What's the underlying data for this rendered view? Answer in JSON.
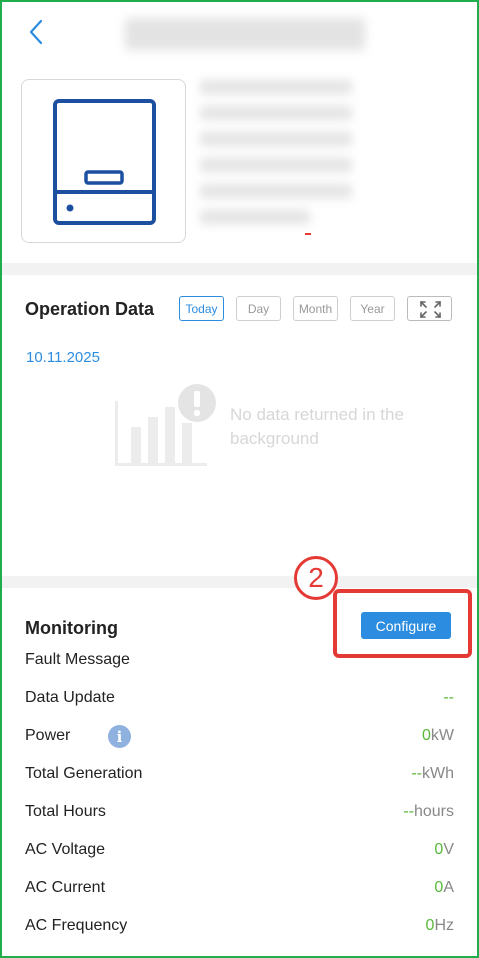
{
  "header": {
    "back_icon": "chevron-left-icon"
  },
  "operation": {
    "title": "Operation Data",
    "ranges": [
      "Today",
      "Day",
      "Month",
      "Year"
    ],
    "active_range": "Today",
    "date": "10.11.2025",
    "empty_message": "No data returned in the background"
  },
  "monitoring": {
    "title": "Monitoring",
    "configure_label": "Configure",
    "annotation": "2",
    "rows": [
      {
        "label": "Fault Message",
        "num": "",
        "unit": ""
      },
      {
        "label": "Data Update",
        "num": "--",
        "unit": ""
      },
      {
        "label": "Power",
        "num": "0",
        "unit": "kW"
      },
      {
        "label": "Total Generation",
        "num": "--",
        "unit": "kWh"
      },
      {
        "label": "Total Hours",
        "num": "--",
        "unit": "hours"
      },
      {
        "label": "AC Voltage",
        "num": "0",
        "unit": "V"
      },
      {
        "label": "AC Current",
        "num": "0",
        "unit": "A"
      },
      {
        "label": "AC Frequency",
        "num": "0",
        "unit": "Hz"
      }
    ]
  },
  "colors": {
    "accent": "#2c8de0",
    "value_green": "#57b93a",
    "annotation_red": "#e53935",
    "frame_green": "#1fae4b"
  }
}
